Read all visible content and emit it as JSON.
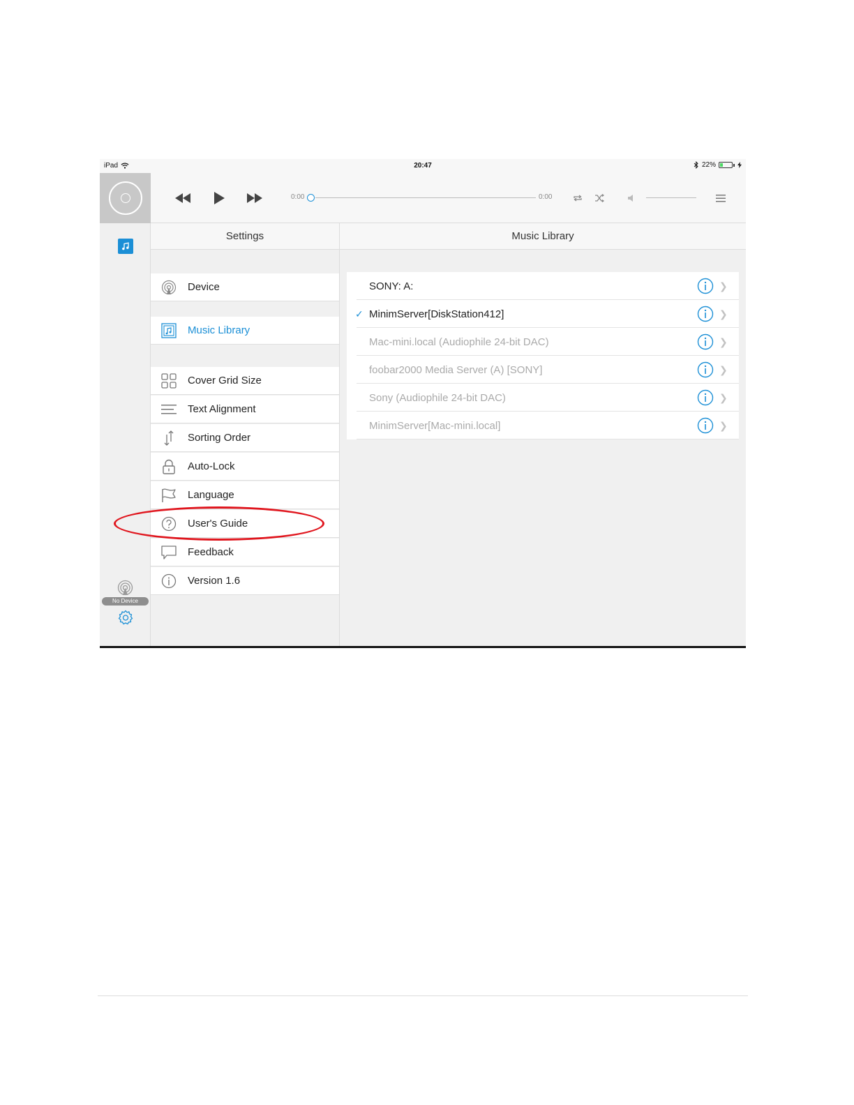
{
  "status_bar": {
    "device": "iPad",
    "time": "20:47",
    "battery_percent": "22%",
    "battery_level": 0.22
  },
  "player": {
    "elapsed": "0:00",
    "duration": "0:00",
    "progress": 0
  },
  "sidebar": {
    "device_status": "No Device"
  },
  "settings": {
    "title": "Settings",
    "groups": [
      [
        {
          "label": "Device",
          "icon": "airplay-icon"
        }
      ],
      [
        {
          "label": "Music Library",
          "icon": "music-library-icon",
          "selected": true
        }
      ],
      [
        {
          "label": "Cover Grid Size",
          "icon": "grid-icon"
        },
        {
          "label": "Text Alignment",
          "icon": "text-align-icon"
        },
        {
          "label": "Sorting Order",
          "icon": "sort-icon"
        },
        {
          "label": "Auto-Lock",
          "icon": "lock-icon"
        },
        {
          "label": "Language",
          "icon": "flag-icon"
        },
        {
          "label": "User's Guide",
          "icon": "help-icon"
        },
        {
          "label": "Feedback",
          "icon": "speech-bubble-icon"
        },
        {
          "label": "Version 1.6",
          "icon": "info-icon"
        }
      ]
    ]
  },
  "library": {
    "title": "Music Library",
    "servers": [
      {
        "name": "SONY: A:",
        "checked": false,
        "available": true
      },
      {
        "name": "MinimServer[DiskStation412]",
        "checked": true,
        "available": true
      },
      {
        "name": "Mac-mini.local (Audiophile 24-bit DAC)",
        "checked": false,
        "available": false
      },
      {
        "name": "foobar2000 Media Server (A) [SONY]",
        "checked": false,
        "available": false
      },
      {
        "name": "Sony (Audiophile 24-bit DAC)",
        "checked": false,
        "available": false
      },
      {
        "name": "MinimServer[Mac-mini.local]",
        "checked": false,
        "available": false
      }
    ]
  },
  "colors": {
    "accent": "#1b8fd6",
    "annotation": "#e0161e"
  }
}
